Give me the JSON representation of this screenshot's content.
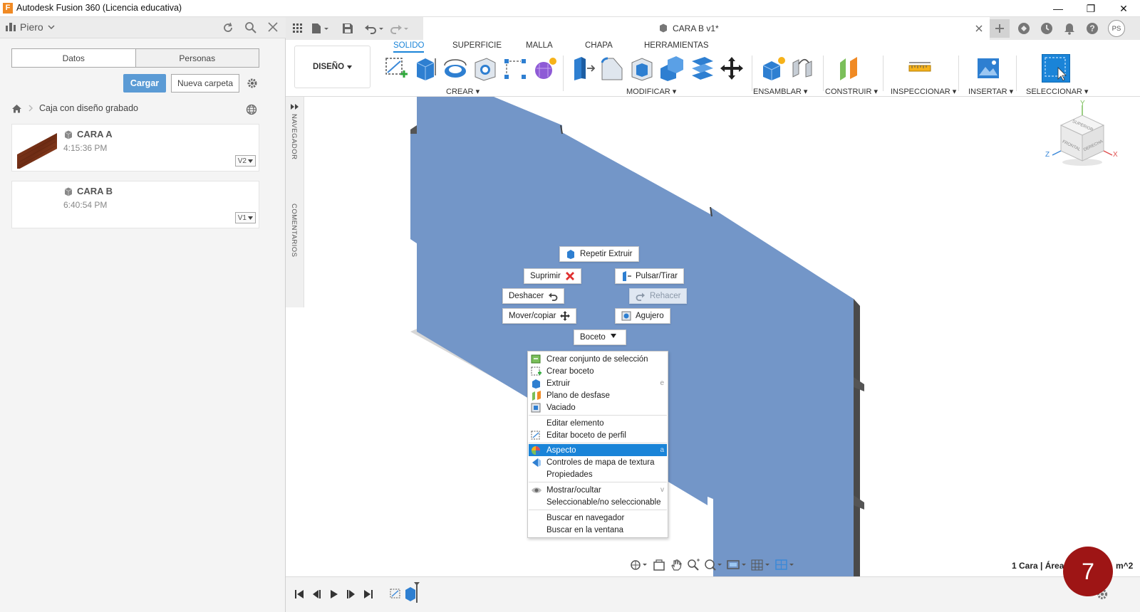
{
  "window": {
    "title": "Autodesk Fusion 360 (Licencia educativa)",
    "logo_letter": "F",
    "controls": [
      "—",
      "❐",
      "✕"
    ]
  },
  "data_panel": {
    "user": "Piero",
    "tabs": [
      "Datos",
      "Personas"
    ],
    "upload_label": "Cargar",
    "new_folder_label": "Nueva carpeta",
    "breadcrumb": "Caja con diseño grabado",
    "files": [
      {
        "name": "CARA A",
        "time": "4:15:36 PM",
        "version": "V2"
      },
      {
        "name": "CARA B",
        "time": "6:40:54 PM",
        "version": "V1"
      }
    ]
  },
  "document": {
    "tab_title": "CARA B v1*"
  },
  "ribbon": {
    "workspace": "DISEÑO",
    "tabs": [
      "SOLIDO",
      "SUPERFICIE",
      "MALLA",
      "CHAPA",
      "HERRAMIENTAS"
    ],
    "active_tab": "SOLIDO",
    "groups": [
      "CREAR",
      "MODIFICAR",
      "ENSAMBLAR",
      "CONSTRUIR",
      "INSPECCIONAR",
      "INSERTAR",
      "SELECCIONAR"
    ]
  },
  "side_strip": {
    "navigator": "NAVEGADOR",
    "comments": "COMENTARIOS"
  },
  "viewcube": {
    "faces": [
      "SUPERIOR",
      "FRONTAL",
      "DERECHA"
    ],
    "axes": [
      "Y",
      "Z",
      "X"
    ]
  },
  "marking_menu": {
    "repeat": "Repetir Extruir",
    "suppress": "Suprimir",
    "pushpull": "Pulsar/Tirar",
    "undo": "Deshacer",
    "redo": "Rehacer",
    "move": "Mover/copiar",
    "hole": "Agujero",
    "sketch": "Boceto"
  },
  "context_menu": {
    "items": [
      {
        "label": "Crear conjunto de selección",
        "icon": "selection-set-icon",
        "shortcut": ""
      },
      {
        "label": "Crear boceto",
        "icon": "sketch-icon",
        "shortcut": ""
      },
      {
        "label": "Extruir",
        "icon": "extrude-icon",
        "shortcut": "e"
      },
      {
        "label": "Plano de desfase",
        "icon": "offset-plane-icon",
        "shortcut": ""
      },
      {
        "label": "Vaciado",
        "icon": "shell-icon",
        "shortcut": ""
      },
      {
        "label": "Editar elemento",
        "icon": "",
        "shortcut": ""
      },
      {
        "label": "Editar boceto de perfil",
        "icon": "sketch-icon",
        "shortcut": ""
      },
      {
        "label": "Aspecto",
        "icon": "appearance-icon",
        "shortcut": "a"
      },
      {
        "label": "Controles de mapa de textura",
        "icon": "texture-map-icon",
        "shortcut": ""
      },
      {
        "label": "Propiedades",
        "icon": "",
        "shortcut": ""
      },
      {
        "label": "Mostrar/ocultar",
        "icon": "eye-icon",
        "shortcut": "v"
      },
      {
        "label": "Seleccionable/no seleccionable",
        "icon": "",
        "shortcut": ""
      },
      {
        "label": "Buscar en navegador",
        "icon": "",
        "shortcut": ""
      },
      {
        "label": "Buscar en la ventana",
        "icon": "",
        "shortcut": ""
      }
    ],
    "highlighted": "Aspecto"
  },
  "status": {
    "text": "1 Cara | Área",
    "suffix": "m^2"
  },
  "badge": "7",
  "colors": {
    "accent": "#1a84d8",
    "face": "#7396c8",
    "edge": "#5e5e5e",
    "badge": "#9e1515"
  }
}
